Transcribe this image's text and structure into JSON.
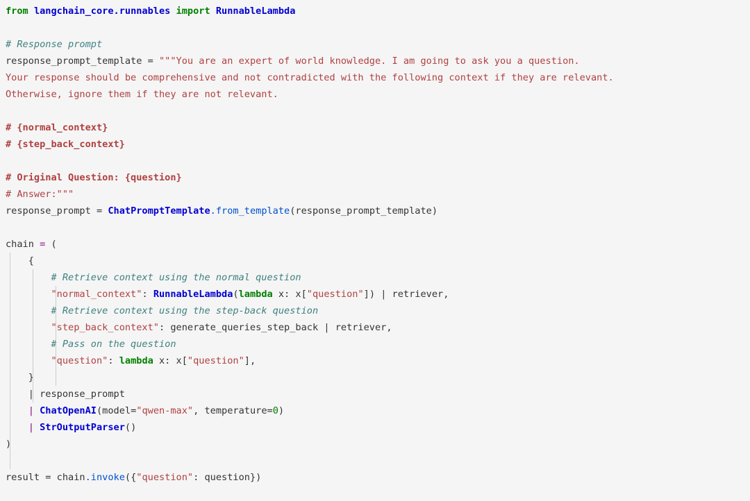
{
  "code": {
    "import": {
      "kw_from": "from",
      "module": "langchain_core.runnables",
      "kw_import": "import",
      "name": "RunnableLambda"
    },
    "c_resp_prompt": "# Response prompt",
    "var_rpt": "response_prompt_template",
    "eq": " = ",
    "triq_open": "\"\"\"",
    "rpt_l1": "You are an expert of world knowledge. I am going to ask you a question.",
    "rpt_l2": "Your response should be comprehensive and not contradicted with the following context if they are relevant.",
    "rpt_l3": "Otherwise, ignore them if they are not relevant.",
    "rpt_l5": "# {normal_context}",
    "rpt_l6": "# {step_back_context}",
    "rpt_l8": "# Original Question: {question}",
    "rpt_l9": "# Answer:",
    "triq_close": "\"\"\"",
    "rp_var": "response_prompt",
    "rp_cls": "ChatPromptTemplate",
    "rp_method": ".from_template",
    "rp_arg": "response_prompt_template",
    "chain_var": "chain",
    "c_retrieve_normal": "# Retrieve context using the normal question",
    "key_nc": "\"normal_context\"",
    "rl_cls": "RunnableLambda",
    "kw_lambda": "lambda",
    "lam_x": " x: x[",
    "q_question": "\"question\"",
    "pipe_retriever": "]) | retriever,",
    "c_retrieve_sb": "# Retrieve context using the step-back question",
    "key_sbc": "\"step_back_context\"",
    "gqsb": ": generate_queries_step_back ",
    "pipe2": "| retriever,",
    "c_pass_q": "# Pass on the question",
    "key_q": "\"question\"",
    "lam2": ": ",
    "lam2_body": " x: x[",
    "lam2_tail": "],",
    "brace_close": "}",
    "pipe_rp": "| response_prompt",
    "pipe_chat": "| ",
    "chat_cls": "ChatOpenAI",
    "chat_args_a": "(model=",
    "chat_model": "\"qwen-max\"",
    "chat_args_b": ", temperature=",
    "chat_temp": "0",
    "chat_args_c": ")",
    "pipe_sop": "| ",
    "sop_cls": "StrOutputParser",
    "sop_tail": "()",
    "paren_close": ")",
    "res_var": "result",
    "res_eq": " = chain",
    "res_invoke": ".invoke",
    "res_open": "({",
    "res_key": "\"question\"",
    "res_mid": ": question})"
  }
}
